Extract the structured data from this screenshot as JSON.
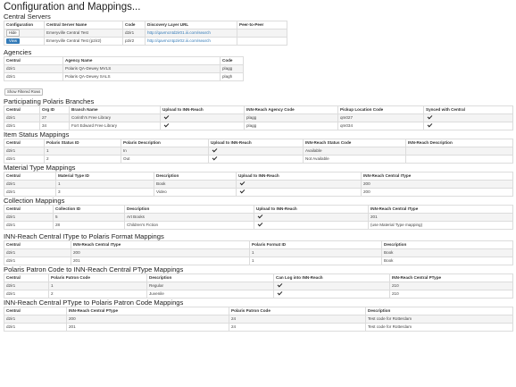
{
  "page_title": "Configuration and Mappings...",
  "central_servers": {
    "title": "Central Servers",
    "headers": [
      "Configuration",
      "Central Server Name",
      "Code",
      "Discovery Layer URL",
      "Peer-to-Peer"
    ],
    "rows": [
      {
        "action": "Hide",
        "name": "Emeryville Central Test",
        "code": "d2ir1",
        "url": "http://qavmcntd2ir01.iii.com/search",
        "p2p": ""
      },
      {
        "action": "View",
        "name": "Emeryville Central Test (p2ir2)",
        "code": "p2ir2",
        "url": "http://qavmcntp2ir02.iii.com/search",
        "p2p": ""
      }
    ]
  },
  "agencies": {
    "title": "Agencies",
    "headers": [
      "Central",
      "Agency Name",
      "Code"
    ],
    "rows": [
      [
        "d2ir1",
        "Polaris QA-Dewey MVLS",
        "plagg"
      ],
      [
        "d2ir1",
        "Polaris QA-Dewey SALS",
        "plagh"
      ]
    ],
    "show_button": "Show Filtered Rows"
  },
  "branches": {
    "title": "Participating Polaris Branches",
    "headers": [
      "Central",
      "Org ID",
      "Branch Name",
      "Upload to INN-Reach",
      "INN-Reach Agency Code",
      "Pickup Location Code",
      "Synced with Central"
    ],
    "rows": [
      [
        "d2ir1",
        "27",
        "Corinth's Free Library",
        "",
        "plagg",
        "qm027",
        ""
      ],
      [
        "d2ir1",
        "34",
        "Fort Edward Free Library",
        "",
        "plagg",
        "qm034",
        ""
      ]
    ]
  },
  "item_status": {
    "title": "Item Status Mappings",
    "headers": [
      "Central",
      "Polaris Status ID",
      "Polaris Description",
      "Upload to INN-Reach",
      "INN-Reach Status Code",
      "INN-Reach Description"
    ],
    "rows": [
      [
        "d2ir1",
        "1",
        "In",
        "",
        "Available",
        ""
      ],
      [
        "d2ir1",
        "2",
        "Out",
        "",
        "Not Available",
        ""
      ]
    ]
  },
  "material_type": {
    "title": "Material Type Mappings",
    "headers": [
      "Central",
      "Material Type ID",
      "Description",
      "Upload to INN-Reach",
      "INN-Reach Central IType"
    ],
    "rows": [
      [
        "d2ir1",
        "1",
        "Book",
        "",
        "200"
      ],
      [
        "d2ir1",
        "3",
        "Video",
        "",
        "200"
      ]
    ]
  },
  "collection": {
    "title": "Collection Mappings",
    "headers": [
      "Central",
      "Collection ID",
      "Description",
      "Upload to INN-Reach",
      "INN-Reach Central IType"
    ],
    "rows": [
      [
        "d2ir1",
        "5",
        "Art Books",
        "",
        "201"
      ],
      [
        "d2ir1",
        "28",
        "Children's Fiction",
        "",
        "(use Material Type mapping)"
      ]
    ]
  },
  "itype_format": {
    "title": "INN-Reach Central IType to Polaris Format Mappings",
    "headers": [
      "Central",
      "INN-Reach Central IType",
      "Polaris Format ID",
      "Description"
    ],
    "rows": [
      [
        "d2ir1",
        "200",
        "1",
        "Book"
      ],
      [
        "d2ir1",
        "201",
        "1",
        "Book"
      ]
    ]
  },
  "patron_code": {
    "title": "Polaris Patron Code to INN-Reach Central PType Mappings",
    "headers": [
      "Central",
      "Polaris Patron Code",
      "Description",
      "Can Log into INN-Reach",
      "INN-Reach Central PType"
    ],
    "rows": [
      [
        "d2ir1",
        "1",
        "Regular",
        "",
        "210"
      ],
      [
        "d2ir1",
        "2",
        "Juvenile",
        "",
        "210"
      ]
    ]
  },
  "ptype_patron": {
    "title": "INN-Reach Central PType to Polaris Patron Code Mappings",
    "headers": [
      "Central",
      "INN-Reach Central PType",
      "Polaris Patron Code",
      "Description"
    ],
    "rows": [
      [
        "d2ir1",
        "200",
        "24",
        "Test code for Rotterdam"
      ],
      [
        "d2ir1",
        "201",
        "24",
        "Test code for Rotterdam"
      ]
    ]
  },
  "colors": {
    "link": "#337ab7",
    "primary_button": "#337ab7",
    "border": "#dcdcdc",
    "stripe": "#f4f4f4"
  },
  "icons": {
    "check": "check-icon"
  }
}
